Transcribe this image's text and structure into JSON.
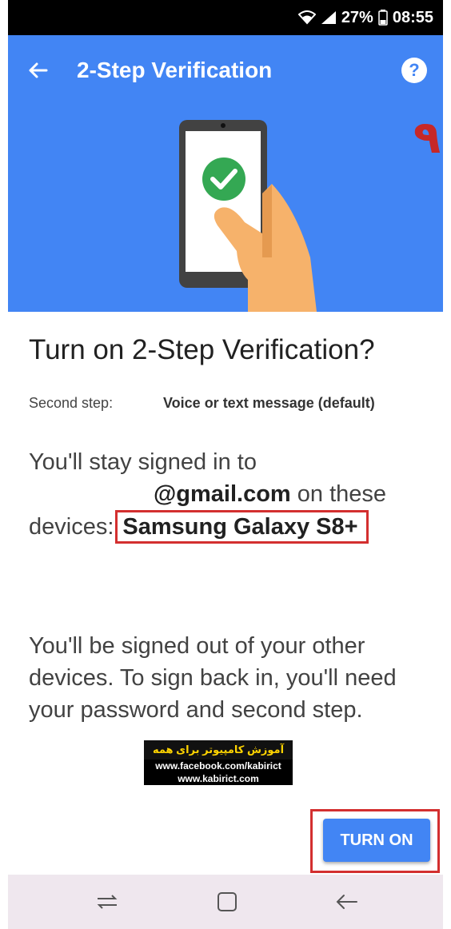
{
  "status_bar": {
    "battery": "27%",
    "time": "08:55"
  },
  "app_bar": {
    "title": "2-Step Verification",
    "help_glyph": "?"
  },
  "hero": {
    "badge_number": "۹"
  },
  "dialog": {
    "title": "Turn on 2-Step Verification?",
    "second_step_label": "Second step:",
    "second_step_value": "Voice or text message (default)",
    "signed_in_line1": "You'll stay signed in to",
    "account_email": "@gmail.com",
    "on_these": " on these",
    "devices_label": "devices:",
    "device_name": "Samsung Galaxy S8+",
    "signout_text": "You'll be signed out of your other devices. To sign back in, you'll need your password and second step."
  },
  "watermark": {
    "farsi": "آموزش کامپیوتر برای همه",
    "url1": "www.facebook.com/kabirict",
    "url2": "www.kabirict.com"
  },
  "actions": {
    "turn_on_label": "TURN ON"
  },
  "colors": {
    "primary": "#4285f4",
    "highlight": "#d32f2f"
  }
}
